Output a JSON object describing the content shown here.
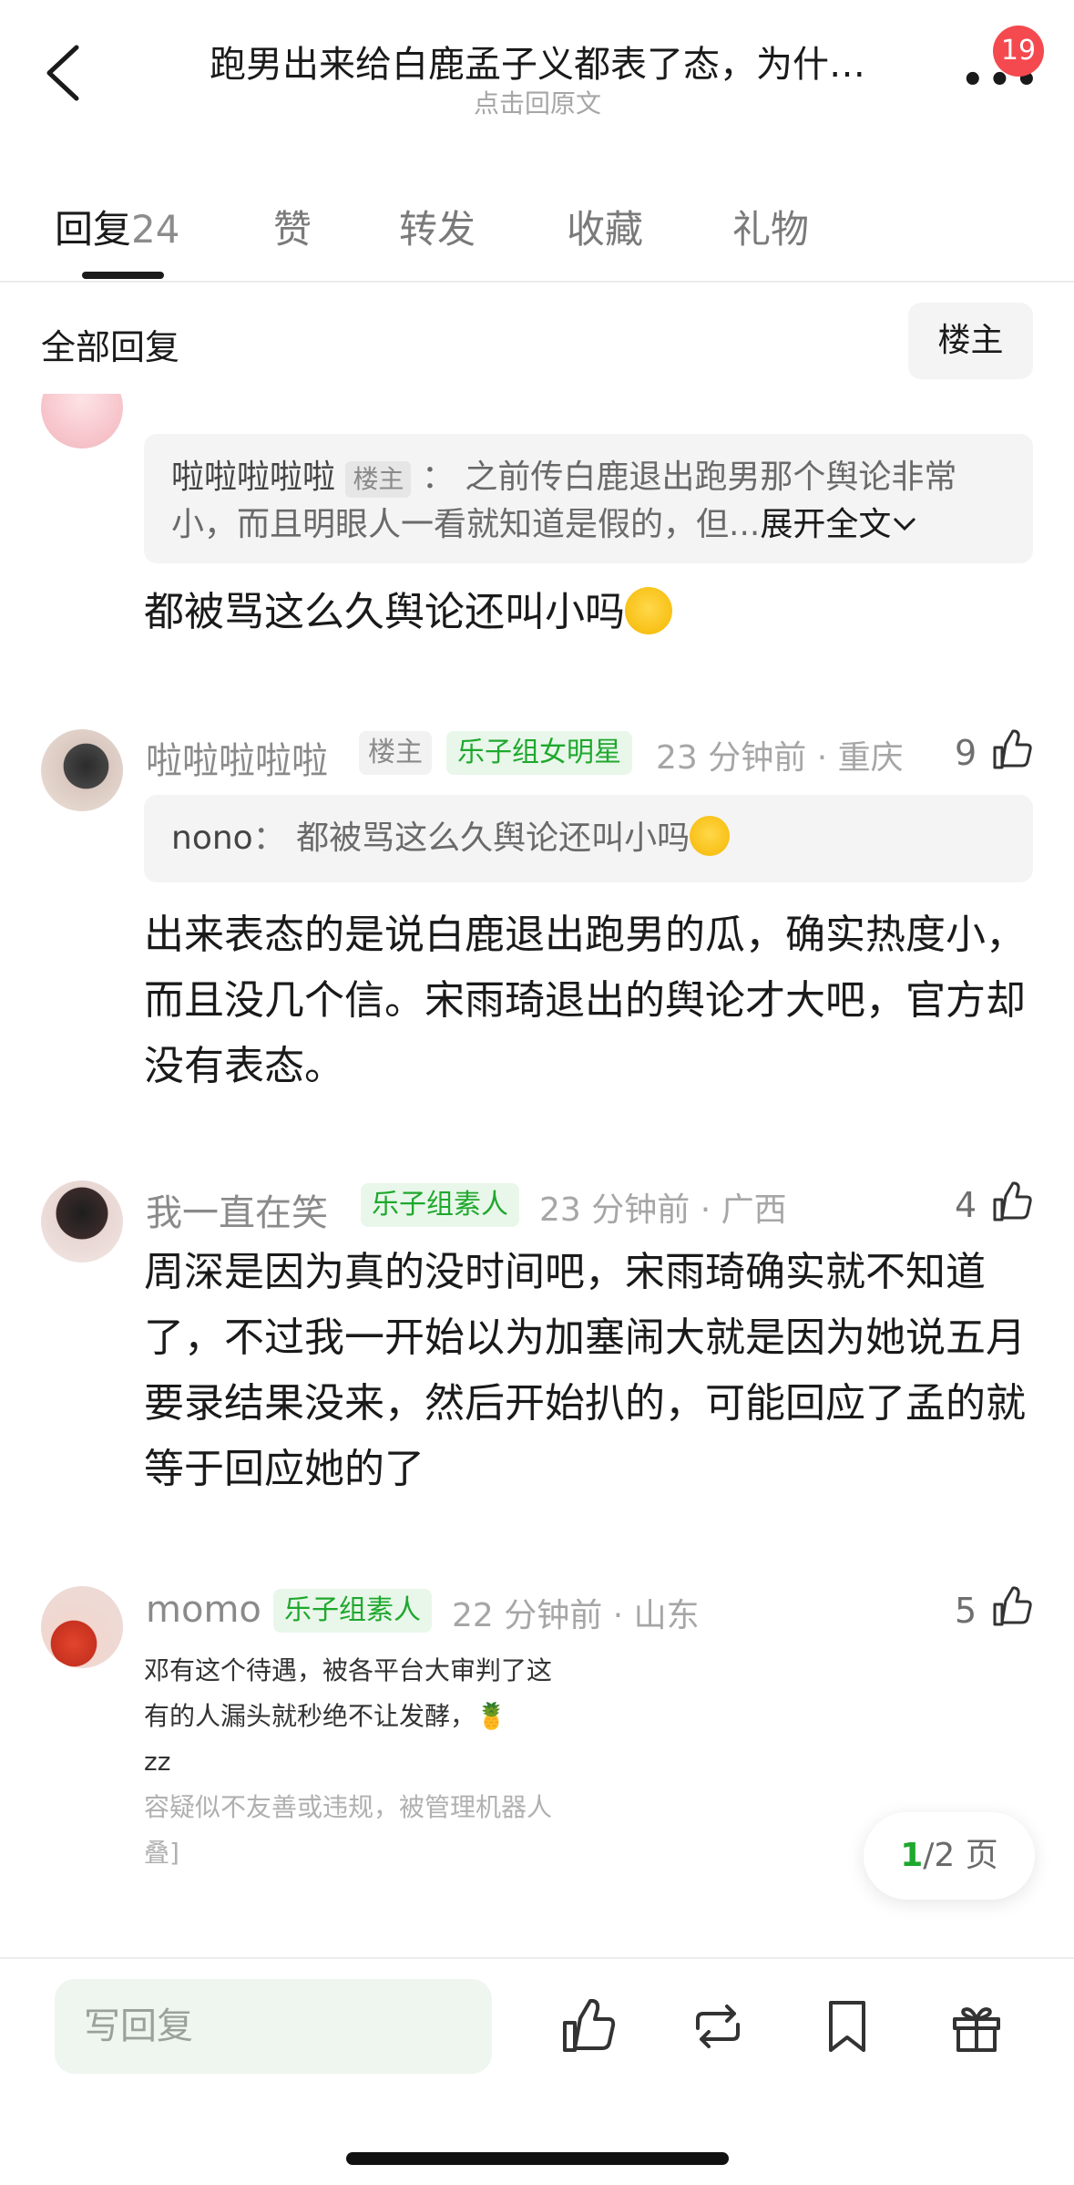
{
  "header": {
    "title": "跑男出来给白鹿孟子义都表了态，为什…",
    "subtitle": "点击回原文",
    "notification_count": "19"
  },
  "tabs": [
    {
      "label": "回复",
      "count": "24"
    },
    {
      "label": "赞"
    },
    {
      "label": "转发"
    },
    {
      "label": "收藏"
    },
    {
      "label": "礼物"
    }
  ],
  "filter": {
    "label": "全部回复",
    "op_button": "楼主"
  },
  "comments": [
    {
      "quote": {
        "author": "啦啦啦啦啦",
        "author_tag": "楼主",
        "sep": "：",
        "text": "之前传白鹿退出跑男那个舆论非常小，而且明眼人一看就知道是假的，但...",
        "expand": "展开全文"
      },
      "body": "都被骂这么久舆论还叫小吗"
    },
    {
      "username": "啦啦啦啦啦",
      "tags": [
        "楼主",
        "乐子组女明星"
      ],
      "meta": "23 分钟前 · 重庆",
      "likes": "9",
      "quote": {
        "author": "nono",
        "sep": "：",
        "text": "都被骂这么久舆论还叫小吗"
      },
      "body": "出来表态的是说白鹿退出跑男的瓜，确实热度小，而且没几个信。宋雨琦退出的舆论才大吧，官方却没有表态。"
    },
    {
      "username": "我一直在笑",
      "tags": [
        "乐子组素人"
      ],
      "meta": "23 分钟前 · 广西",
      "likes": "4",
      "body": "周深是因为真的没时间吧，宋雨琦确实就不知道了，不过我一开始以为加塞闹大就是因为她说五月要录结果没来，然后开始扒的，可能回应了孟的就等于回应她的了"
    },
    {
      "username": "momo",
      "tags": [
        "乐子组素人"
      ],
      "meta": "22 分钟前 · 山东",
      "likes": "5",
      "folded_lines": [
        "邓有这个待遇，被各平台大审判了这",
        "有的人漏头就秒绝不让发酵，🍍",
        "zz",
        "容疑似不友善或违规，被管理机器人",
        "叠]"
      ]
    }
  ],
  "pager": {
    "current": "1",
    "total": "/2 页"
  },
  "bottom_bar": {
    "reply_placeholder": "写回复"
  },
  "colors": {
    "accent_green": "#1fa82e",
    "badge_red": "#f4494f"
  }
}
